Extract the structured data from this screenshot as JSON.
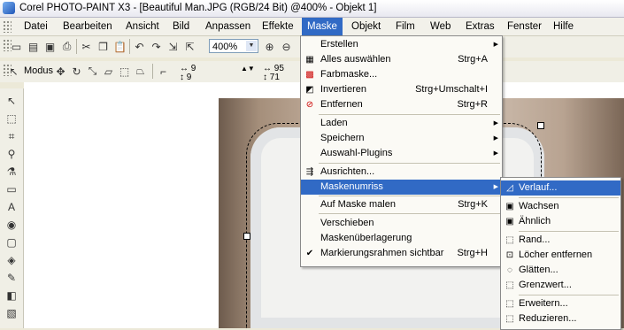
{
  "window": {
    "title": "Corel PHOTO-PAINT X3 - [Beautiful Man.JPG (RGB/24 Bit) @400% - Objekt 1]"
  },
  "menubar": [
    "Datei",
    "Bearbeiten",
    "Ansicht",
    "Bild",
    "Anpassen",
    "Effekte",
    "Maske",
    "Objekt",
    "Film",
    "Web",
    "Extras",
    "Fenster",
    "Hilfe"
  ],
  "toolbar": {
    "zoom": "400%",
    "modus_label": "Modus"
  },
  "property_bar": {
    "x": "9",
    "y": "9",
    "w": "95",
    "h": "71"
  },
  "mask_menu": {
    "items": [
      {
        "label": "Erstellen",
        "shortcut": "",
        "submenu": true,
        "icon": ""
      },
      {
        "label": "Alles auswählen",
        "shortcut": "Strg+A",
        "submenu": false,
        "icon": "select-all-icon"
      },
      {
        "label": "Farbmaske...",
        "shortcut": "",
        "submenu": false,
        "icon": "color-mask-icon"
      },
      {
        "label": "Invertieren",
        "shortcut": "Strg+Umschalt+I",
        "submenu": false,
        "icon": "invert-icon"
      },
      {
        "label": "Entfernen",
        "shortcut": "Strg+R",
        "submenu": false,
        "icon": "remove-icon"
      },
      {
        "label": "Laden",
        "shortcut": "",
        "submenu": true,
        "icon": ""
      },
      {
        "label": "Speichern",
        "shortcut": "",
        "submenu": true,
        "icon": ""
      },
      {
        "label": "Auswahl-Plugins",
        "shortcut": "",
        "submenu": true,
        "icon": ""
      },
      {
        "label": "Ausrichten...",
        "shortcut": "",
        "submenu": false,
        "icon": "align-icon"
      },
      {
        "label": "Maskenumriss",
        "shortcut": "",
        "submenu": true,
        "icon": ""
      },
      {
        "label": "Auf Maske malen",
        "shortcut": "Strg+K",
        "submenu": false,
        "icon": ""
      },
      {
        "label": "Verschieben",
        "shortcut": "",
        "submenu": false,
        "icon": ""
      },
      {
        "label": "Maskenüberlagerung",
        "shortcut": "",
        "submenu": false,
        "icon": ""
      },
      {
        "label": "Markierungsrahmen sichtbar",
        "shortcut": "Strg+H",
        "submenu": false,
        "icon": "checkmark-icon"
      }
    ]
  },
  "outline_submenu": {
    "items": [
      {
        "label": "Verlauf...",
        "icon": "feather-icon"
      },
      {
        "label": "Wachsen",
        "icon": "grow-icon"
      },
      {
        "label": "Ähnlich",
        "icon": "similar-icon"
      },
      {
        "label": "Rand...",
        "icon": "border-icon"
      },
      {
        "label": "Löcher entfernen",
        "icon": "remove-holes-icon"
      },
      {
        "label": "Glätten...",
        "icon": "smooth-icon"
      },
      {
        "label": "Grenzwert...",
        "icon": "threshold-icon"
      },
      {
        "label": "Erweitern...",
        "icon": "expand-icon"
      },
      {
        "label": "Reduzieren...",
        "icon": "reduce-icon"
      }
    ]
  },
  "colors": {
    "highlight": "#316ac5",
    "menu_bg": "#fbfaf5"
  }
}
